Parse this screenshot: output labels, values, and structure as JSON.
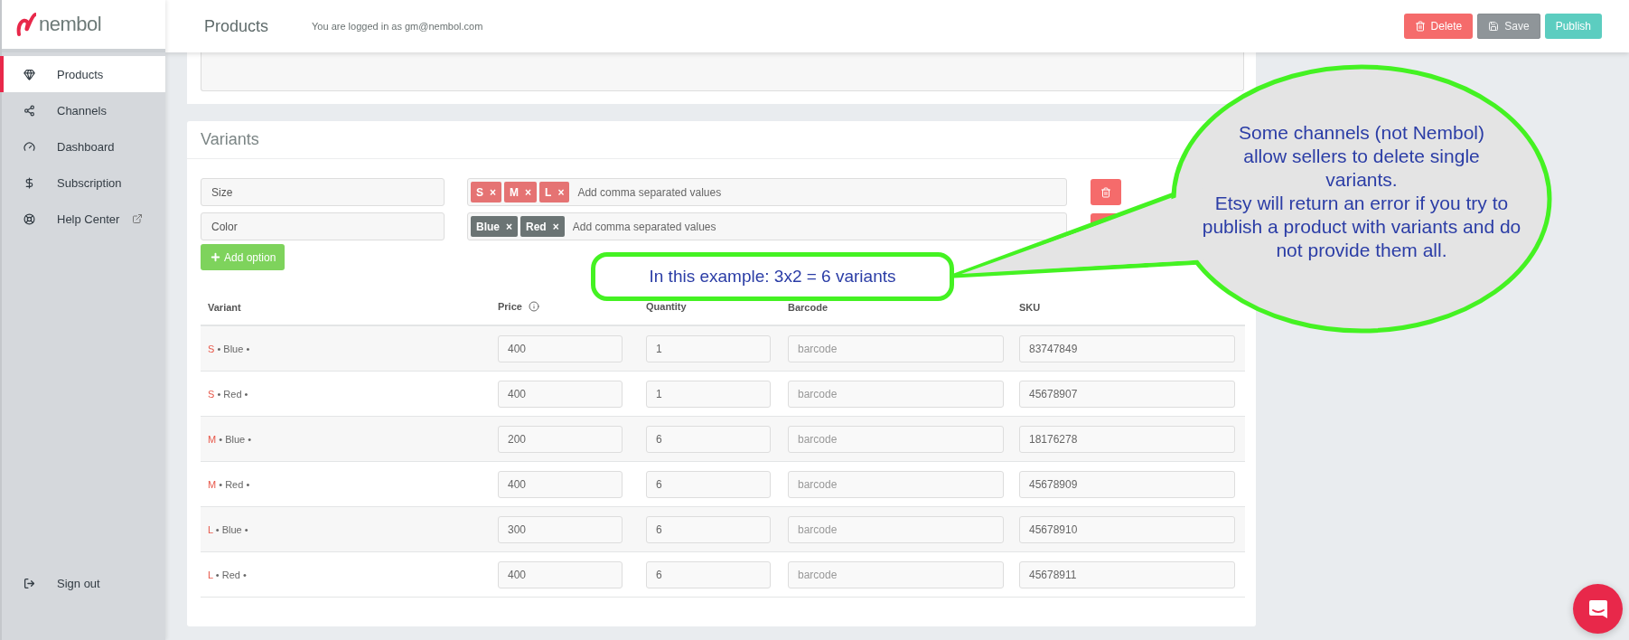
{
  "brand": {
    "name": "nembol"
  },
  "sidebar": {
    "items": [
      {
        "label": "Products",
        "selected": true,
        "external": false
      },
      {
        "label": "Channels",
        "selected": false,
        "external": false
      },
      {
        "label": "Dashboard",
        "selected": false,
        "external": false
      },
      {
        "label": "Subscription",
        "selected": false,
        "external": false
      },
      {
        "label": "Help Center",
        "selected": false,
        "external": true
      }
    ],
    "footer": {
      "label": "Sign out"
    }
  },
  "header": {
    "title": "Products",
    "login_note": "You are logged in as gm@nembol.com",
    "buttons": [
      {
        "label": "Delete",
        "kind": "danger",
        "disabled": false
      },
      {
        "label": "Save",
        "kind": "save",
        "disabled": true
      },
      {
        "label": "Publish",
        "kind": "primary",
        "disabled": false
      }
    ]
  },
  "variants": {
    "title": "Variants",
    "remove_mark": "×",
    "options": [
      {
        "name": "Size",
        "color": "#e57373",
        "values": [
          "S",
          "M",
          "L"
        ],
        "placeholder": "Add comma separated values"
      },
      {
        "name": "Color",
        "color": "#6b7474",
        "values": [
          "Blue",
          "Red"
        ],
        "placeholder": "Add comma separated values"
      }
    ],
    "add_option": "Add option"
  },
  "table": {
    "columns": [
      "Variant",
      "Price",
      "Quantity",
      "Barcode",
      "SKU"
    ],
    "separator": "•",
    "rows": [
      {
        "size": "S",
        "color_value": "Blue",
        "price": "400",
        "quantity": "1",
        "barcode_placeholder": "barcode",
        "sku": "83747849"
      },
      {
        "size": "S",
        "color_value": "Red",
        "price": "400",
        "quantity": "1",
        "barcode_placeholder": "barcode",
        "sku": "45678907"
      },
      {
        "size": "M",
        "color_value": "Blue",
        "price": "200",
        "quantity": "6",
        "barcode_placeholder": "barcode",
        "sku": "18176278"
      },
      {
        "size": "M",
        "color_value": "Red",
        "price": "400",
        "quantity": "6",
        "barcode_placeholder": "barcode",
        "sku": "45678909"
      },
      {
        "size": "L",
        "color_value": "Blue",
        "price": "300",
        "quantity": "6",
        "barcode_placeholder": "barcode",
        "sku": "45678910"
      },
      {
        "size": "L",
        "color_value": "Red",
        "price": "400",
        "quantity": "6",
        "barcode_placeholder": "barcode",
        "sku": "45678911"
      }
    ]
  },
  "annotations": {
    "callout": [
      "Some channels (not Nembol) allow sellers to delete single variants.",
      "Etsy will return an error if you try to publish a product with variants and do not provide them all."
    ],
    "example": "In this example: 3x2 = 6 variants"
  }
}
